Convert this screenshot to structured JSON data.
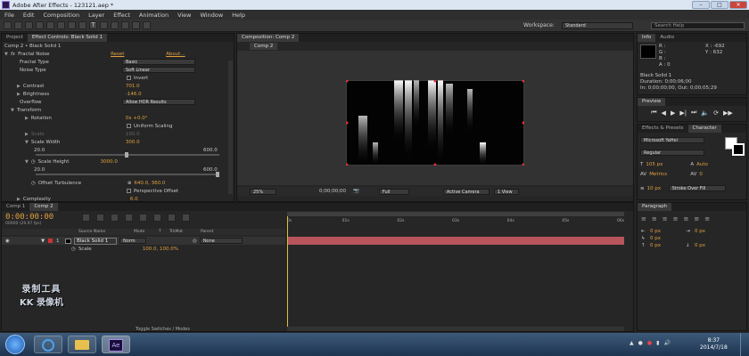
{
  "window": {
    "title": "Adobe After Effects - 123121.aep *",
    "min": "–",
    "max": "□",
    "close": "✕"
  },
  "menu": [
    "File",
    "Edit",
    "Composition",
    "Layer",
    "Effect",
    "Animation",
    "View",
    "Window",
    "Help"
  ],
  "toolbar": {
    "workspace_label": "Workspace:",
    "workspace_value": "Standard",
    "search_placeholder": "Search Help"
  },
  "effect_panel": {
    "tabs": [
      "Project",
      "Effect Controls: Black Solid 1"
    ],
    "header": "Comp 2 • Black Solid 1",
    "effect_name": "Fractal Noise",
    "reset": "Reset",
    "about": "About...",
    "props": [
      {
        "label": "Fractal Type",
        "value": "Basic",
        "kind": "dd"
      },
      {
        "label": "Noise Type",
        "value": "Soft Linear",
        "kind": "dd"
      },
      {
        "label": "",
        "value": "Invert",
        "kind": "check"
      },
      {
        "label": "Contrast",
        "value": "701.0",
        "kind": "num"
      },
      {
        "label": "Brightness",
        "value": "-146.0",
        "kind": "num"
      },
      {
        "label": "Overflow",
        "value": "Allow HDR Results",
        "kind": "dd"
      },
      {
        "label": "Transform",
        "value": "",
        "kind": "group"
      },
      {
        "label": "Rotation",
        "value": "0x +0.0°",
        "kind": "num"
      },
      {
        "label": "",
        "value": "Uniform Scaling",
        "kind": "check"
      },
      {
        "label": "Scale",
        "value": "100.0",
        "kind": "dim"
      },
      {
        "label": "Scale Width",
        "value": "300.0",
        "kind": "num"
      }
    ],
    "slider1_min": "20.0",
    "slider1_max": "600.0",
    "scale_height_label": "Scale Height",
    "scale_height_value": "3000.0",
    "slider2_min": "20.0",
    "slider2_max": "600.0",
    "offset_label": "Offset Turbulence",
    "offset_value": "640.0, 360.0",
    "perspective": "Perspective Offset",
    "complexity": "Complexity",
    "complexity_value": "6.0"
  },
  "composition": {
    "tab": "Composition: Comp 2",
    "sub_tab": "Comp 2",
    "zoom": "25%",
    "timecode": "0;00;00;00",
    "resolution": "Full",
    "camera": "Active Camera",
    "views": "1 View"
  },
  "info_panel": {
    "tabs": [
      "Info",
      "Audio"
    ],
    "r": "R :",
    "g": "G :",
    "b": "B :",
    "a": "A : 0",
    "x": "X : -692",
    "y": "Y : 632",
    "layer": "Black Solid 1",
    "duration": "Duration: 0;00;06;00",
    "in": "In: 0;00;00;00, Out: 0;00;05;29"
  },
  "preview": {
    "title": "Preview"
  },
  "char_panel": {
    "tabs": [
      "Effects & Presets",
      "Character"
    ],
    "font": "Microsoft YaHei",
    "style": "Regular",
    "size": "105 px",
    "leading": "Auto",
    "kerning": "Metrics",
    "tracking": "0",
    "stroke_size": "10 px",
    "stroke_type": "Stroke Over Fill"
  },
  "paragraph": {
    "title": "Paragraph",
    "v1": "0 px",
    "v2": "0 px",
    "v3": "0 px",
    "v4": "0 px",
    "v5": "0 px"
  },
  "timeline": {
    "tabs": [
      "Comp 1",
      "Comp 2"
    ],
    "timecode": "0:00:00:00",
    "fps": "00000 (29.97 fps)",
    "cols": {
      "source": "Source Name",
      "mode": "Mode",
      "t": "T",
      "trkmat": "TrkMat",
      "parent": "Parent"
    },
    "layer_num": "1",
    "layer_name": "Black Solid 1",
    "layer_mode": "Norm",
    "layer_parent": "None",
    "scale_label": "Scale",
    "scale_value": "100.0, 100.0%",
    "ruler": [
      "0s",
      "01s",
      "02s",
      "03s",
      "04s",
      "05s",
      "06s"
    ],
    "toggle": "Toggle Switches / Modes"
  },
  "watermark": {
    "line1": "录制工具",
    "line2": "KK 录像机"
  },
  "taskbar": {
    "time": "8:37",
    "date": "2014/7/18",
    "ae": "Ae"
  }
}
